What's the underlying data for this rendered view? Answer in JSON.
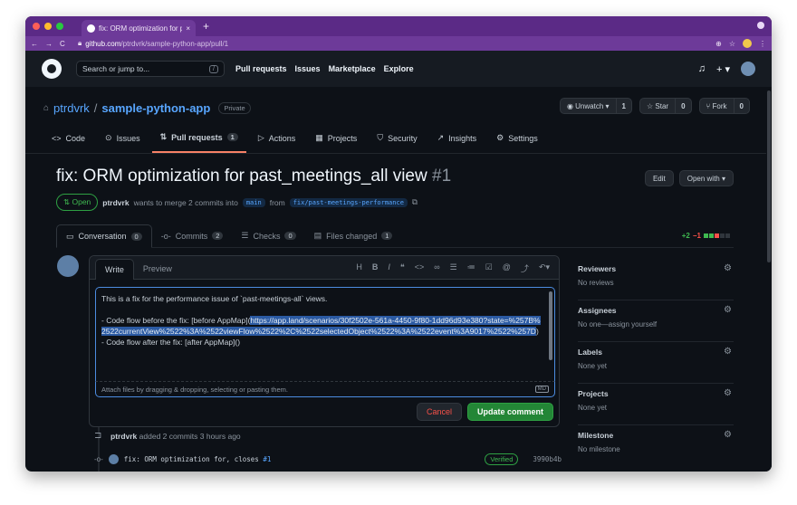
{
  "browser": {
    "tab_title": "fix: ORM optimization for past...",
    "tab_close": "×",
    "new_tab": "+",
    "url_host": "github.com",
    "url_path": "/ptrdvrk/sample-python-app/pull/1",
    "nav_back": "←",
    "nav_forward": "→",
    "nav_reload": "C"
  },
  "gh_header": {
    "search_placeholder": "Search or jump to...",
    "search_key": "/",
    "nav": [
      "Pull requests",
      "Issues",
      "Marketplace",
      "Explore"
    ],
    "bell": "🔔",
    "plus": "+ ▾"
  },
  "repo": {
    "owner": "ptrdvrk",
    "separator": "/",
    "name": "sample-python-app",
    "visibility": "Private",
    "unwatch_label": "Unwatch ▾",
    "unwatch_count": "1",
    "star_label": "☆ Star",
    "star_count": "0",
    "fork_label": "Fork",
    "fork_count": "0",
    "tabs": [
      {
        "icon": "<>",
        "label": "Code"
      },
      {
        "icon": "⊙",
        "label": "Issues"
      },
      {
        "icon": "⇅",
        "label": "Pull requests",
        "count": "1"
      },
      {
        "icon": "▷",
        "label": "Actions"
      },
      {
        "icon": "▦",
        "label": "Projects"
      },
      {
        "icon": "⛉",
        "label": "Security"
      },
      {
        "icon": "↗",
        "label": "Insights"
      },
      {
        "icon": "⚙",
        "label": "Settings"
      }
    ]
  },
  "pr": {
    "title": "fix: ORM optimization for past_meetings_all view",
    "number": "#1",
    "state": "Open",
    "author": "ptrdvrk",
    "meta_text": "wants to merge 2 commits into",
    "base_branch": "main",
    "from_text": "from",
    "head_branch": "fix/past-meetings-performance",
    "edit_label": "Edit",
    "open_with_label": "Open with ▾",
    "tabs": [
      {
        "label": "Conversation",
        "count": "0"
      },
      {
        "label": "Commits",
        "count": "2"
      },
      {
        "label": "Checks",
        "count": "0"
      },
      {
        "label": "Files changed",
        "count": "1"
      }
    ],
    "additions": "+2",
    "deletions": "−1"
  },
  "editor": {
    "write_tab": "Write",
    "preview_tab": "Preview",
    "line1": "This is a fix for the performance issue of `past-meetings-all` views.",
    "line2_pre": "- Code flow before the fix: [before AppMap](",
    "line2_link": "https://app.land/scenarios/30f2502e-561a-4450-9f80-1dd96d93e380?state=%257B%2522currentView%2522%3A%2522viewFlow%2522%2C%2522selectedObject%2522%3A%2522event%3A9017%2522%257D",
    "line2_post": ")",
    "line3": "- Code flow after the fix: [after AppMap]()",
    "attach_text": "Attach files by dragging & dropping, selecting or pasting them.",
    "md_badge": "MD",
    "cancel_label": "Cancel",
    "update_label": "Update comment"
  },
  "timeline": {
    "author": "ptrdvrk",
    "event_text": "added 2 commits 3 hours ago",
    "commit_msg": "fix: ORM optimization for, closes",
    "commit_ref": "#1",
    "verified": "Verified",
    "sha": "3990b4b"
  },
  "sidebar": [
    {
      "heading": "Reviewers",
      "value": "No reviews"
    },
    {
      "heading": "Assignees",
      "value": "No one—assign yourself"
    },
    {
      "heading": "Labels",
      "value": "None yet"
    },
    {
      "heading": "Projects",
      "value": "None yet"
    },
    {
      "heading": "Milestone",
      "value": "No milestone"
    }
  ],
  "colors": {
    "accent_link": "#58a6ff",
    "open_green": "#3fb950",
    "browser_purple": "#5b2a86"
  }
}
